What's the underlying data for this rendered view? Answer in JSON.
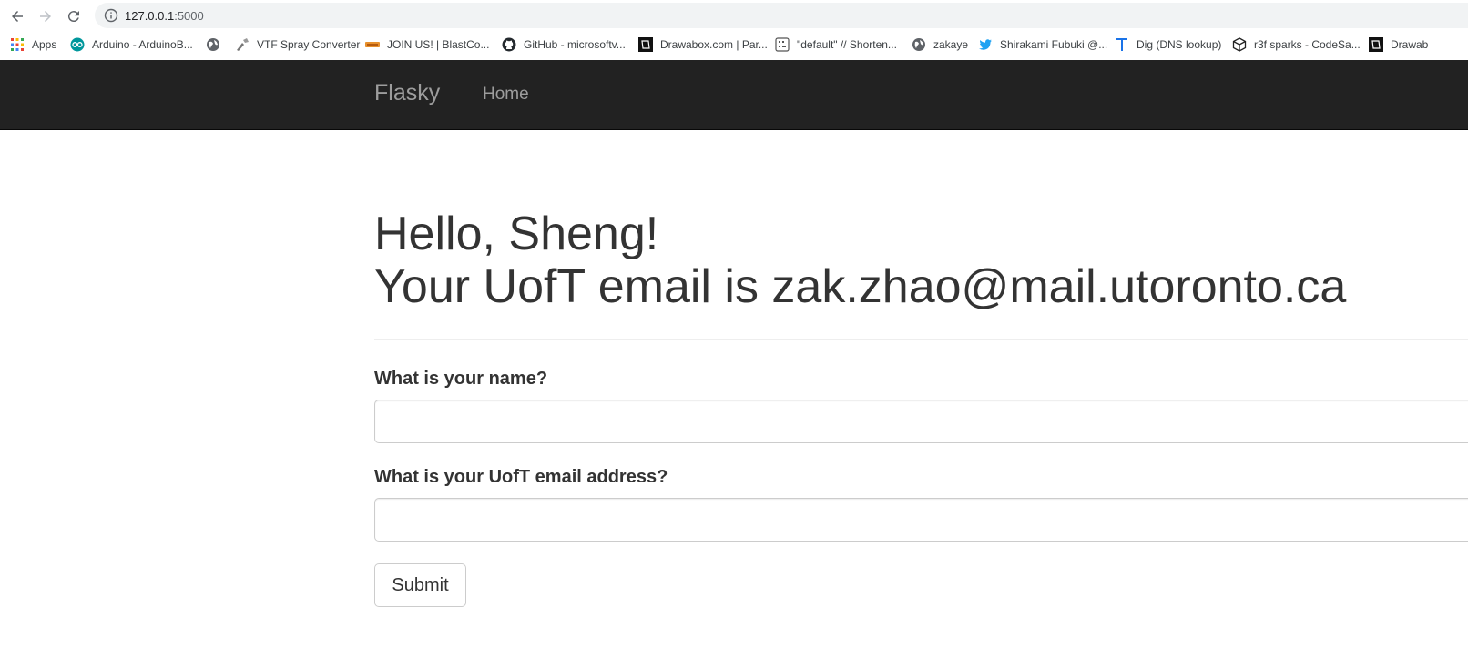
{
  "browser": {
    "url_host": "127.0.0.1",
    "url_port": ":5000",
    "bookmarks": [
      {
        "label": "Apps",
        "icon": "apps-grid-icon"
      },
      {
        "label": "Arduino - ArduinoB...",
        "icon": "arduino-icon"
      },
      {
        "label": "",
        "icon": "globe-icon"
      },
      {
        "label": "VTF Spray Converter",
        "icon": "spray-icon"
      },
      {
        "label": "JOIN US! | BlastCo...",
        "icon": "blast-icon"
      },
      {
        "label": "GitHub - microsoftv...",
        "icon": "github-icon"
      },
      {
        "label": "Drawabox.com | Par...",
        "icon": "drawabox-icon"
      },
      {
        "label": "\"default\" // Shorten...",
        "icon": "shorten-icon"
      },
      {
        "label": "zakaye",
        "icon": "globe-icon"
      },
      {
        "label": "Shirakami Fubuki @...",
        "icon": "twitter-icon"
      },
      {
        "label": "Dig (DNS lookup)",
        "icon": "t-letter-icon"
      },
      {
        "label": "r3f sparks - CodeSa...",
        "icon": "codesandbox-icon"
      },
      {
        "label": "Drawab",
        "icon": "drawabox-icon"
      }
    ]
  },
  "navbar": {
    "brand": "Flasky",
    "home": "Home",
    "bg_color": "#222222",
    "text_color": "#9d9d9d"
  },
  "header": {
    "greeting": "Hello, Sheng!",
    "email_line": "Your UofT email is zak.zhao@mail.utoronto.ca"
  },
  "form": {
    "name_label": "What is your name?",
    "name_value": "",
    "email_label": "What is your UofT email address?",
    "email_value": "",
    "submit_label": "Submit"
  }
}
